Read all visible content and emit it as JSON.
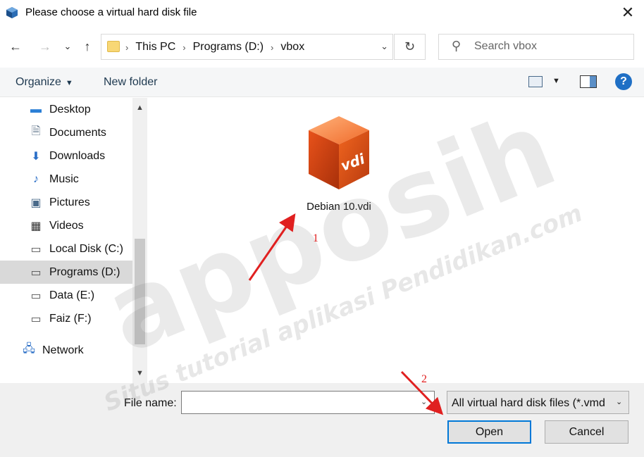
{
  "window": {
    "title": "Please choose a virtual hard disk file",
    "close_glyph": "✕"
  },
  "navigation": {
    "back": "←",
    "forward": "→",
    "recent": "⌄",
    "up": "↑",
    "breadcrumbs": [
      "This PC",
      "Programs (D:)",
      "vbox"
    ],
    "refresh": "↻",
    "search_placeholder": "Search vbox"
  },
  "toolbar": {
    "organize": "Organize",
    "new_folder": "New folder",
    "help": "?"
  },
  "sidebar": {
    "items": [
      {
        "label": "Desktop",
        "icon": "desktop-icon",
        "glyph": "▬"
      },
      {
        "label": "Documents",
        "icon": "documents-icon",
        "glyph": "🗎"
      },
      {
        "label": "Downloads",
        "icon": "downloads-icon",
        "glyph": "⬇"
      },
      {
        "label": "Music",
        "icon": "music-icon",
        "glyph": "♪"
      },
      {
        "label": "Pictures",
        "icon": "pictures-icon",
        "glyph": "▣"
      },
      {
        "label": "Videos",
        "icon": "videos-icon",
        "glyph": "▦"
      },
      {
        "label": "Local Disk (C:)",
        "icon": "local-disk-icon",
        "glyph": "▭"
      },
      {
        "label": "Programs (D:)",
        "icon": "drive-icon",
        "glyph": "▭",
        "selected": true
      },
      {
        "label": "Data (E:)",
        "icon": "drive-icon",
        "glyph": "▭"
      },
      {
        "label": "Faiz (F:)",
        "icon": "drive-icon",
        "glyph": "▭"
      },
      {
        "label": "Network",
        "icon": "network-icon",
        "glyph": "🖧"
      }
    ]
  },
  "files": [
    {
      "name": "Debian 10.vdi",
      "icon": "vdi-file-icon",
      "icon_text": "vdi"
    }
  ],
  "bottom": {
    "file_name_label": "File name:",
    "file_name_value": "",
    "filter_value": "All virtual hard disk files (*.vmd",
    "open_label": "Open",
    "cancel_label": "Cancel"
  },
  "watermark": {
    "brand": "apposih",
    "tagline": "Situs tutorial aplikasi Pendidikan.com"
  },
  "annotations": {
    "step1": "1",
    "step2": "2",
    "color": "#e02020"
  }
}
